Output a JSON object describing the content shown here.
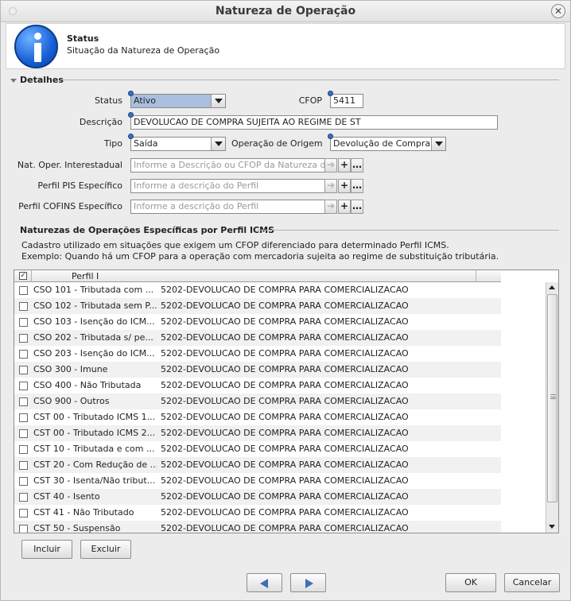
{
  "window": {
    "title": "Natureza de Operação"
  },
  "header": {
    "title": "Status",
    "subtitle": "Situação da Natureza de Operação"
  },
  "details": {
    "section_title": "Detalhes",
    "status_label": "Status",
    "status_value": "Ativo",
    "cfop_label": "CFOP",
    "cfop_value": "5411",
    "descricao_label": "Descrição",
    "descricao_value": "DEVOLUCAO DE COMPRA SUJEITA AO REGIME DE ST",
    "tipo_label": "Tipo",
    "tipo_value": "Saída",
    "origem_label": "Operação de Origem",
    "origem_value": "Devolução de Compra",
    "interestadual_label": "Nat. Oper. Interestadual",
    "interestadual_placeholder": "Informe a Descrição ou CFOP da Natureza de",
    "pis_label": "Perfil PIS Específico",
    "pis_placeholder": "Informe a descrição do Perfil",
    "cofins_label": "Perfil COFINS Específico",
    "cofins_placeholder": "Informe a descrição do Perfil"
  },
  "icms": {
    "section_title": "Naturezas de Operações Específicas por Perfil ICMS",
    "desc_line1": "Cadastro utilizado em situações que exigem um CFOP diferenciado para determinado Perfil ICMS.",
    "desc_line2": "Exemplo: Quando há um CFOP para a operação com mercadoria sujeita ao regime de substituição tributária.",
    "column_header": "Perfil I",
    "rows": [
      {
        "perfil": "CSO 101 - Tributada com ...",
        "cfop": "5202-DEVOLUCAO DE COMPRA PARA COMERCIALIZACAO"
      },
      {
        "perfil": "CSO 102 - Tributada sem P...",
        "cfop": "5202-DEVOLUCAO DE COMPRA PARA COMERCIALIZACAO"
      },
      {
        "perfil": "CSO 103 - Isenção do ICM...",
        "cfop": "5202-DEVOLUCAO DE COMPRA PARA COMERCIALIZACAO"
      },
      {
        "perfil": "CSO 202 - Tributada s/ pe...",
        "cfop": "5202-DEVOLUCAO DE COMPRA PARA COMERCIALIZACAO"
      },
      {
        "perfil": "CSO 203 - Isenção do ICM...",
        "cfop": "5202-DEVOLUCAO DE COMPRA PARA COMERCIALIZACAO"
      },
      {
        "perfil": "CSO 300 - Imune",
        "cfop": "5202-DEVOLUCAO DE COMPRA PARA COMERCIALIZACAO"
      },
      {
        "perfil": "CSO 400 - Não Tributada",
        "cfop": "5202-DEVOLUCAO DE COMPRA PARA COMERCIALIZACAO"
      },
      {
        "perfil": "CSO 900 - Outros",
        "cfop": "5202-DEVOLUCAO DE COMPRA PARA COMERCIALIZACAO"
      },
      {
        "perfil": "CST 00 - Tributado ICMS 1...",
        "cfop": "5202-DEVOLUCAO DE COMPRA PARA COMERCIALIZACAO"
      },
      {
        "perfil": "CST 00 - Tributado ICMS 2...",
        "cfop": "5202-DEVOLUCAO DE COMPRA PARA COMERCIALIZACAO"
      },
      {
        "perfil": "CST 10 - Tributada e com ...",
        "cfop": "5202-DEVOLUCAO DE COMPRA PARA COMERCIALIZACAO"
      },
      {
        "perfil": "CST 20 - Com Redução de ...",
        "cfop": "5202-DEVOLUCAO DE COMPRA PARA COMERCIALIZACAO"
      },
      {
        "perfil": "CST 30 - Isenta/Não tribut...",
        "cfop": "5202-DEVOLUCAO DE COMPRA PARA COMERCIALIZACAO"
      },
      {
        "perfil": "CST 40 - Isento",
        "cfop": "5202-DEVOLUCAO DE COMPRA PARA COMERCIALIZACAO"
      },
      {
        "perfil": "CST 41 - Não Tributado",
        "cfop": "5202-DEVOLUCAO DE COMPRA PARA COMERCIALIZACAO"
      },
      {
        "perfil": "CST 50 - Suspensão",
        "cfop": "5202-DEVOLUCAO DE COMPRA PARA COMERCIALIZACAO"
      }
    ],
    "include_label": "Incluir",
    "exclude_label": "Excluir"
  },
  "footer": {
    "ok_label": "OK",
    "cancel_label": "Cancelar"
  },
  "colors": {
    "accent": "#3c6fb8",
    "selection": "#a9bfdf",
    "header_bg": "#ffffff"
  }
}
